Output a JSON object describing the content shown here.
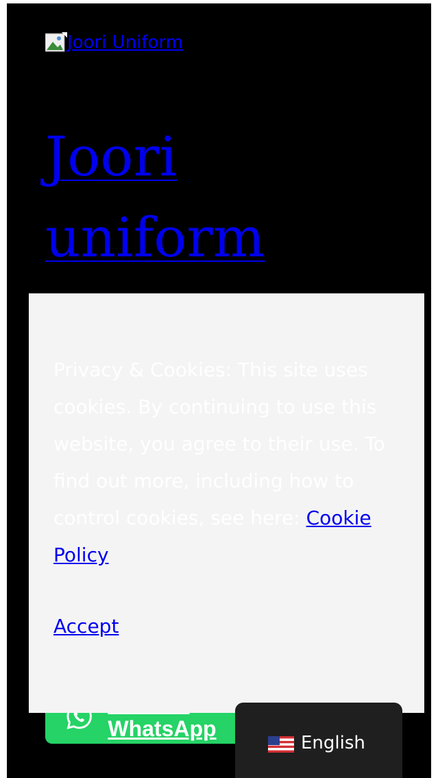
{
  "header": {
    "logo_alt": "Joori Uniform",
    "site_title": "Joori uniform"
  },
  "whatsapp": {
    "label": "Chat on WhatsApp",
    "color": "#25d366"
  },
  "cookie_banner": {
    "text": "Privacy & Cookies: This site uses cookies. By continuing to use this website, you agree to their use. To find out more, including how to control cookies, see here: ",
    "policy_link": "Cookie Policy",
    "accept_label": "Accept",
    "background": "#f4f4f4"
  },
  "language": {
    "current": "English",
    "flag_icon": "us-flag-icon"
  },
  "colors": {
    "page_bg": "#000000",
    "link": "#0000ee"
  }
}
